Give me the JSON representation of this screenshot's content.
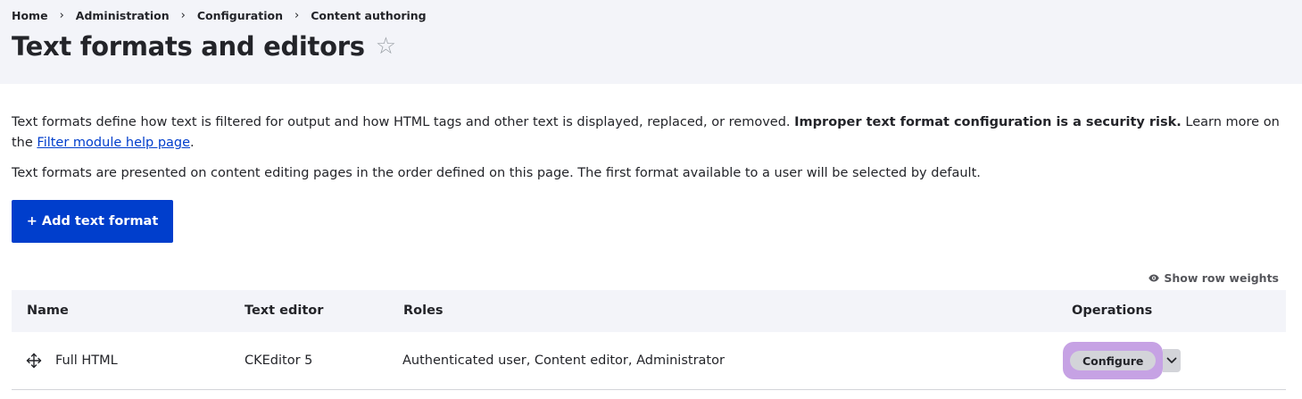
{
  "breadcrumb": [
    "Home",
    "Administration",
    "Configuration",
    "Content authoring"
  ],
  "page": {
    "title": "Text formats and editors"
  },
  "description": {
    "p1_before": "Text formats define how text is filtered for output and how HTML tags and other text is displayed, replaced, or removed. ",
    "p1_bold": "Improper text format configuration is a security risk.",
    "p1_after": " Learn more on the ",
    "p1_link": "Filter module help page",
    "p1_end": ".",
    "p2": "Text formats are presented on content editing pages in the order defined on this page. The first format available to a user will be selected by default."
  },
  "actions": {
    "add_text_format": "+ Add text format",
    "show_row_weights": "Show row weights"
  },
  "table": {
    "headers": {
      "name": "Name",
      "text_editor": "Text editor",
      "roles": "Roles",
      "operations": "Operations"
    },
    "rows": [
      {
        "name": "Full HTML",
        "text_editor": "CKEditor 5",
        "roles": "Authenticated user, Content editor, Administrator",
        "operation": "Configure"
      }
    ]
  },
  "colors": {
    "primary": "#003ecc",
    "header_bg": "#f3f4f9",
    "focus_ring": "#c6a2e4"
  },
  "icons": {
    "favorite": "star-outline-icon",
    "row_weights": "eye-icon",
    "drag": "drag-handle-icon",
    "dropdown": "chevron-down-icon"
  }
}
